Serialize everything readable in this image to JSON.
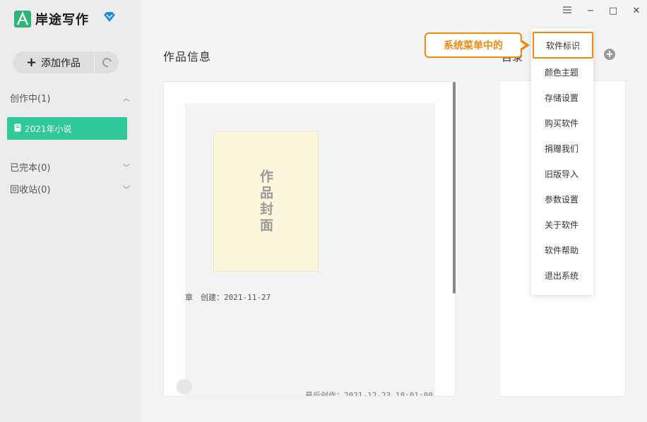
{
  "app": {
    "title": "岸途写作",
    "logo_icon": "app-logo-icon",
    "vip_icon": "diamond-icon",
    "accent": "#2fc89a",
    "brand_green": "#2bb673"
  },
  "window": {
    "menu_icon": "hamburger-icon",
    "minimize_glyph": "−",
    "maximize_glyph": "□",
    "close_glyph": "✕"
  },
  "sidebar": {
    "add_label": "添加作品",
    "add_icon": "plus-icon",
    "refresh_icon": "refresh-icon",
    "sections": [
      {
        "label": "创作中(1)",
        "chevron": "chevron-up-icon"
      },
      {
        "label": "已完本(0)",
        "chevron": "chevron-down-icon"
      },
      {
        "label": "回收站(0)",
        "chevron": "chevron-down-icon"
      }
    ],
    "book": {
      "label": "2021年小说",
      "icon": "book-icon"
    }
  },
  "main": {
    "title": "作品信息",
    "cover_text": "作品封面",
    "chapter_fragment": "章",
    "created": "创建：2021-11-27",
    "last_edit": "最后创作：2021-12-23 18:01:00",
    "right_title_fragment": "目录",
    "add_icon": "plus-circle-icon"
  },
  "callout": {
    "text": "系统菜单中的",
    "color": "#f08a0c"
  },
  "menu": {
    "items": [
      {
        "label": "软件标识",
        "highlight": true
      },
      {
        "label": "颜色主题"
      },
      {
        "label": "存储设置"
      },
      {
        "label": "购买软件"
      },
      {
        "label": "捐赠我们"
      },
      {
        "label": "旧版导入"
      },
      {
        "label": "参数设置"
      },
      {
        "label": "关于软件"
      },
      {
        "label": "软件帮助"
      },
      {
        "label": "退出系统"
      }
    ]
  }
}
